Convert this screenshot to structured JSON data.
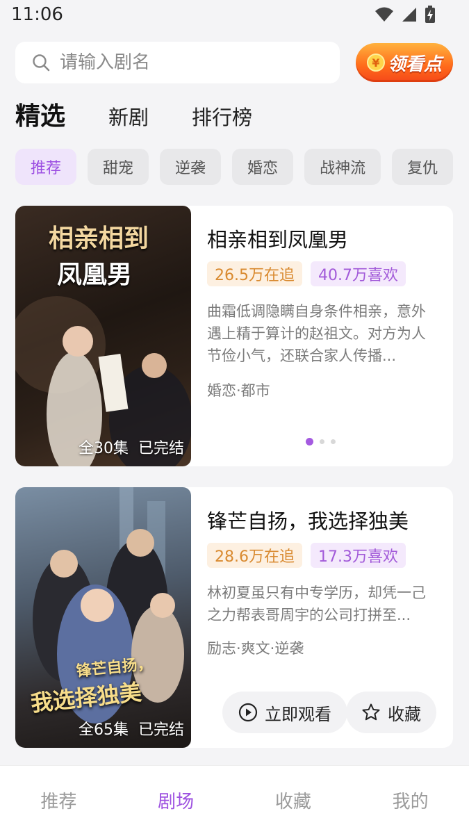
{
  "status_bar": {
    "time": "11:06",
    "icons": [
      "wifi-icon",
      "signal-icon",
      "battery-charging-icon"
    ]
  },
  "search": {
    "placeholder": "请输入剧名",
    "icon": "search-icon"
  },
  "reward_button": {
    "label": "领看点",
    "coin_symbol": "¥"
  },
  "top_tabs": [
    {
      "label": "精选",
      "active": true
    },
    {
      "label": "新剧",
      "active": false
    },
    {
      "label": "排行榜",
      "active": false
    }
  ],
  "categories": [
    {
      "label": "推荐",
      "active": true
    },
    {
      "label": "甜宠",
      "active": false
    },
    {
      "label": "逆袭",
      "active": false
    },
    {
      "label": "婚恋",
      "active": false
    },
    {
      "label": "战神流",
      "active": false
    },
    {
      "label": "复仇",
      "active": false
    }
  ],
  "dramas": [
    {
      "title": "相亲相到凤凰男",
      "poster_title_line1": "相亲相到",
      "poster_title_line2": "凤凰男",
      "episodes": "全30集",
      "status": "已完结",
      "following": "26.5万在追",
      "likes": "40.7万喜欢",
      "synopsis": "曲霜低调隐瞒自身条件相亲，意外遇上精于算计的赵祖文。对方为人节俭小气，还联合家人传播...",
      "genres": "婚恋·都市"
    },
    {
      "title": "锋芒自扬，我选择独美",
      "poster_title_line1": "锋芒自扬，",
      "poster_title_line2": "我选择独美",
      "episodes": "全65集",
      "status": "已完结",
      "following": "28.6万在追",
      "likes": "17.3万喜欢",
      "synopsis": "林初夏虽只有中专学历，却凭一己之力帮表哥周宇的公司打拼至...",
      "genres": "励志·爽文·逆袭",
      "watch_label": "立即观看",
      "favorite_label": "收藏"
    }
  ],
  "carousel": {
    "pages": 3,
    "active_index": 0
  },
  "bottom_nav": [
    {
      "label": "推荐",
      "active": false
    },
    {
      "label": "剧场",
      "active": true
    },
    {
      "label": "收藏",
      "active": false
    },
    {
      "label": "我的",
      "active": false
    }
  ],
  "colors": {
    "accent": "#9e52e0",
    "follow_badge_text": "#d98a30",
    "like_badge_text": "#a25ad9",
    "reward_gradient_top": "#ffb23e",
    "reward_gradient_bottom": "#f5481a"
  }
}
